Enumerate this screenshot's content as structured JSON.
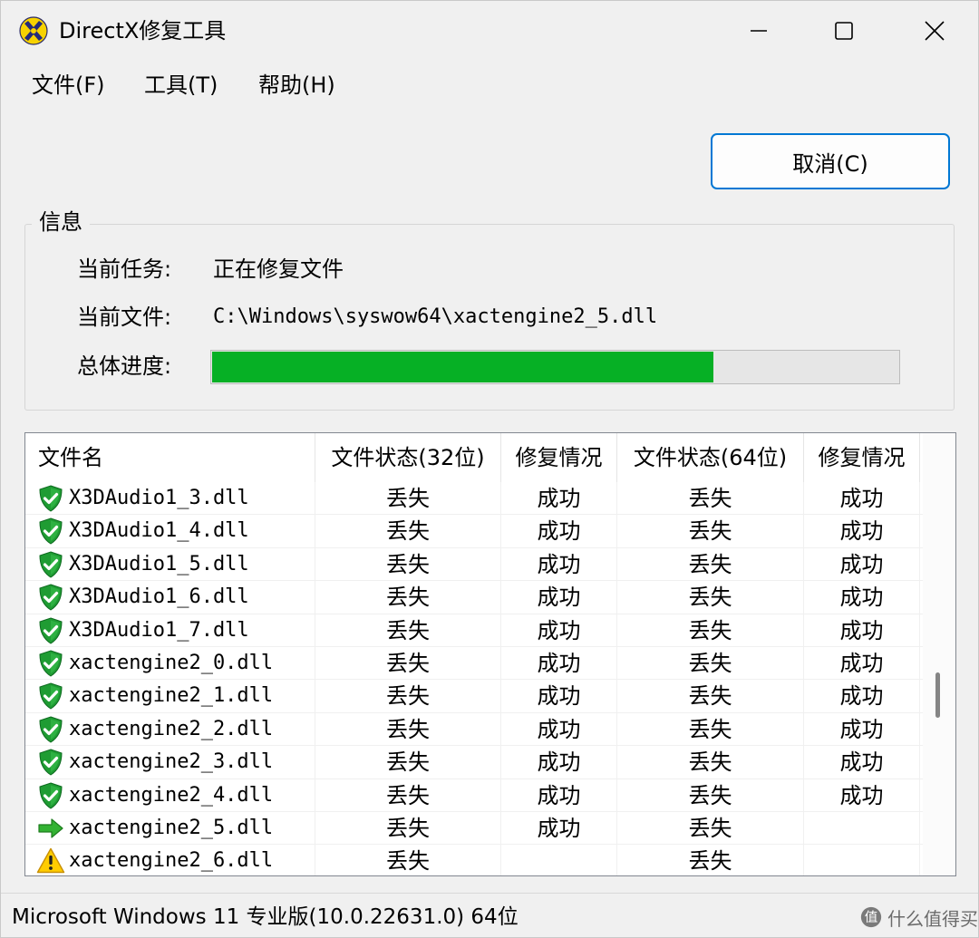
{
  "window": {
    "title": "DirectX修复工具",
    "icons": {
      "app": "directx-logo-icon",
      "minimize": "minimize-icon",
      "maximize": "maximize-icon",
      "close": "close-icon"
    }
  },
  "menu": {
    "items": [
      {
        "label": "文件(F)"
      },
      {
        "label": "工具(T)"
      },
      {
        "label": "帮助(H)"
      }
    ]
  },
  "cancel_button": {
    "label": "取消(C)"
  },
  "info": {
    "legend": "信息",
    "current_task_label": "当前任务:",
    "current_task_value": "正在修复文件",
    "current_file_label": "当前文件:",
    "current_file_value": "C:\\Windows\\syswow64\\xactengine2_5.dll",
    "progress_label": "总体进度:",
    "progress_fraction": 0.73,
    "progress_color": "#06b025"
  },
  "list": {
    "columns": [
      "文件名",
      "文件状态(32位)",
      "修复情况",
      "文件状态(64位)",
      "修复情况"
    ],
    "rows": [
      {
        "icon": "shield-check-icon",
        "name": "X3DAudio1_3.dll",
        "s32": "丢失",
        "r32": "成功",
        "s64": "丢失",
        "r64": "成功"
      },
      {
        "icon": "shield-check-icon",
        "name": "X3DAudio1_4.dll",
        "s32": "丢失",
        "r32": "成功",
        "s64": "丢失",
        "r64": "成功"
      },
      {
        "icon": "shield-check-icon",
        "name": "X3DAudio1_5.dll",
        "s32": "丢失",
        "r32": "成功",
        "s64": "丢失",
        "r64": "成功"
      },
      {
        "icon": "shield-check-icon",
        "name": "X3DAudio1_6.dll",
        "s32": "丢失",
        "r32": "成功",
        "s64": "丢失",
        "r64": "成功"
      },
      {
        "icon": "shield-check-icon",
        "name": "X3DAudio1_7.dll",
        "s32": "丢失",
        "r32": "成功",
        "s64": "丢失",
        "r64": "成功"
      },
      {
        "icon": "shield-check-icon",
        "name": "xactengine2_0.dll",
        "s32": "丢失",
        "r32": "成功",
        "s64": "丢失",
        "r64": "成功"
      },
      {
        "icon": "shield-check-icon",
        "name": "xactengine2_1.dll",
        "s32": "丢失",
        "r32": "成功",
        "s64": "丢失",
        "r64": "成功"
      },
      {
        "icon": "shield-check-icon",
        "name": "xactengine2_2.dll",
        "s32": "丢失",
        "r32": "成功",
        "s64": "丢失",
        "r64": "成功"
      },
      {
        "icon": "shield-check-icon",
        "name": "xactengine2_3.dll",
        "s32": "丢失",
        "r32": "成功",
        "s64": "丢失",
        "r64": "成功"
      },
      {
        "icon": "shield-check-icon",
        "name": "xactengine2_4.dll",
        "s32": "丢失",
        "r32": "成功",
        "s64": "丢失",
        "r64": "成功"
      },
      {
        "icon": "green-arrow-icon",
        "name": "xactengine2_5.dll",
        "s32": "丢失",
        "r32": "成功",
        "s64": "丢失",
        "r64": ""
      },
      {
        "icon": "warning-icon",
        "name": "xactengine2_6.dll",
        "s32": "丢失",
        "r32": "",
        "s64": "丢失",
        "r64": ""
      }
    ]
  },
  "status_bar": {
    "text": "Microsoft Windows 11 专业版(10.0.22631.0) 64位"
  },
  "watermark": {
    "text": "什么值得买",
    "icon": "smzdm-logo-icon"
  }
}
